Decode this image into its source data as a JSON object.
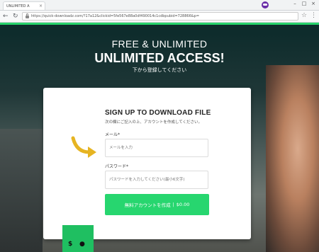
{
  "browser": {
    "tab_title": "UNLIMITED A",
    "url": "https://quick-downloadz.com/?17a12&clickid=5fe567e88a0df490014c1cdbpubid=728866&p=",
    "controls": [
      "–",
      "□",
      "×"
    ]
  },
  "hero": {
    "line1": "FREE & UNLIMITED",
    "line2": "UNLIMITED ACCESS!",
    "subtitle": "下から登録してください"
  },
  "form": {
    "title": "SIGN UP TO DOWNLOAD FILE",
    "description": "次の欄にご記入の上、アカウントを作成してください。",
    "email_label": "メール*",
    "email_placeholder": "メールを入力",
    "password_label": "パスワード*",
    "password_placeholder": "パスワードを入力してください(最小6文字)",
    "submit_label": "無料アカウントを作成",
    "submit_separator": "|",
    "submit_price": "$0.00"
  },
  "colors": {
    "accent": "#27d66f",
    "arrow": "#e6b422"
  },
  "icons": {
    "profile": "incognito-icon",
    "lock": "lock-icon",
    "star": "bookmark-star-icon",
    "menu": "menu-icon",
    "arrow": "curved-arrow-icon"
  }
}
